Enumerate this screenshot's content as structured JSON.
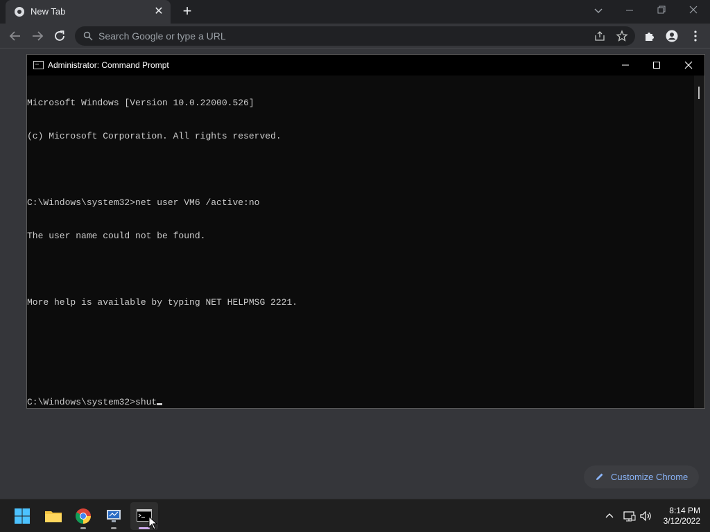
{
  "browser": {
    "tab_title": "New Tab",
    "omnibox_placeholder": "Search Google or type a URL",
    "customize_label": "Customize Chrome"
  },
  "cmd": {
    "title": "Administrator: Command Prompt",
    "lines": [
      "Microsoft Windows [Version 10.0.22000.526]",
      "(c) Microsoft Corporation. All rights reserved.",
      "",
      "C:\\Windows\\system32>net user VM6 /active:no",
      "The user name could not be found.",
      "",
      "More help is available by typing NET HELPMSG 2221.",
      "",
      ""
    ],
    "prompt_line": "C:\\Windows\\system32>shut"
  },
  "taskbar": {
    "apps": [
      "start-icon",
      "file-explorer-icon",
      "chrome-icon",
      "remote-desktop-icon",
      "command-prompt-icon"
    ],
    "time": "8:14 PM",
    "date": "3/12/2022"
  },
  "colors": {
    "chrome_dark": "#202124",
    "toolbar": "#35363a",
    "console_bg": "#0c0c0c",
    "console_text": "#cccccc",
    "link_blue": "#8ab4f8"
  }
}
